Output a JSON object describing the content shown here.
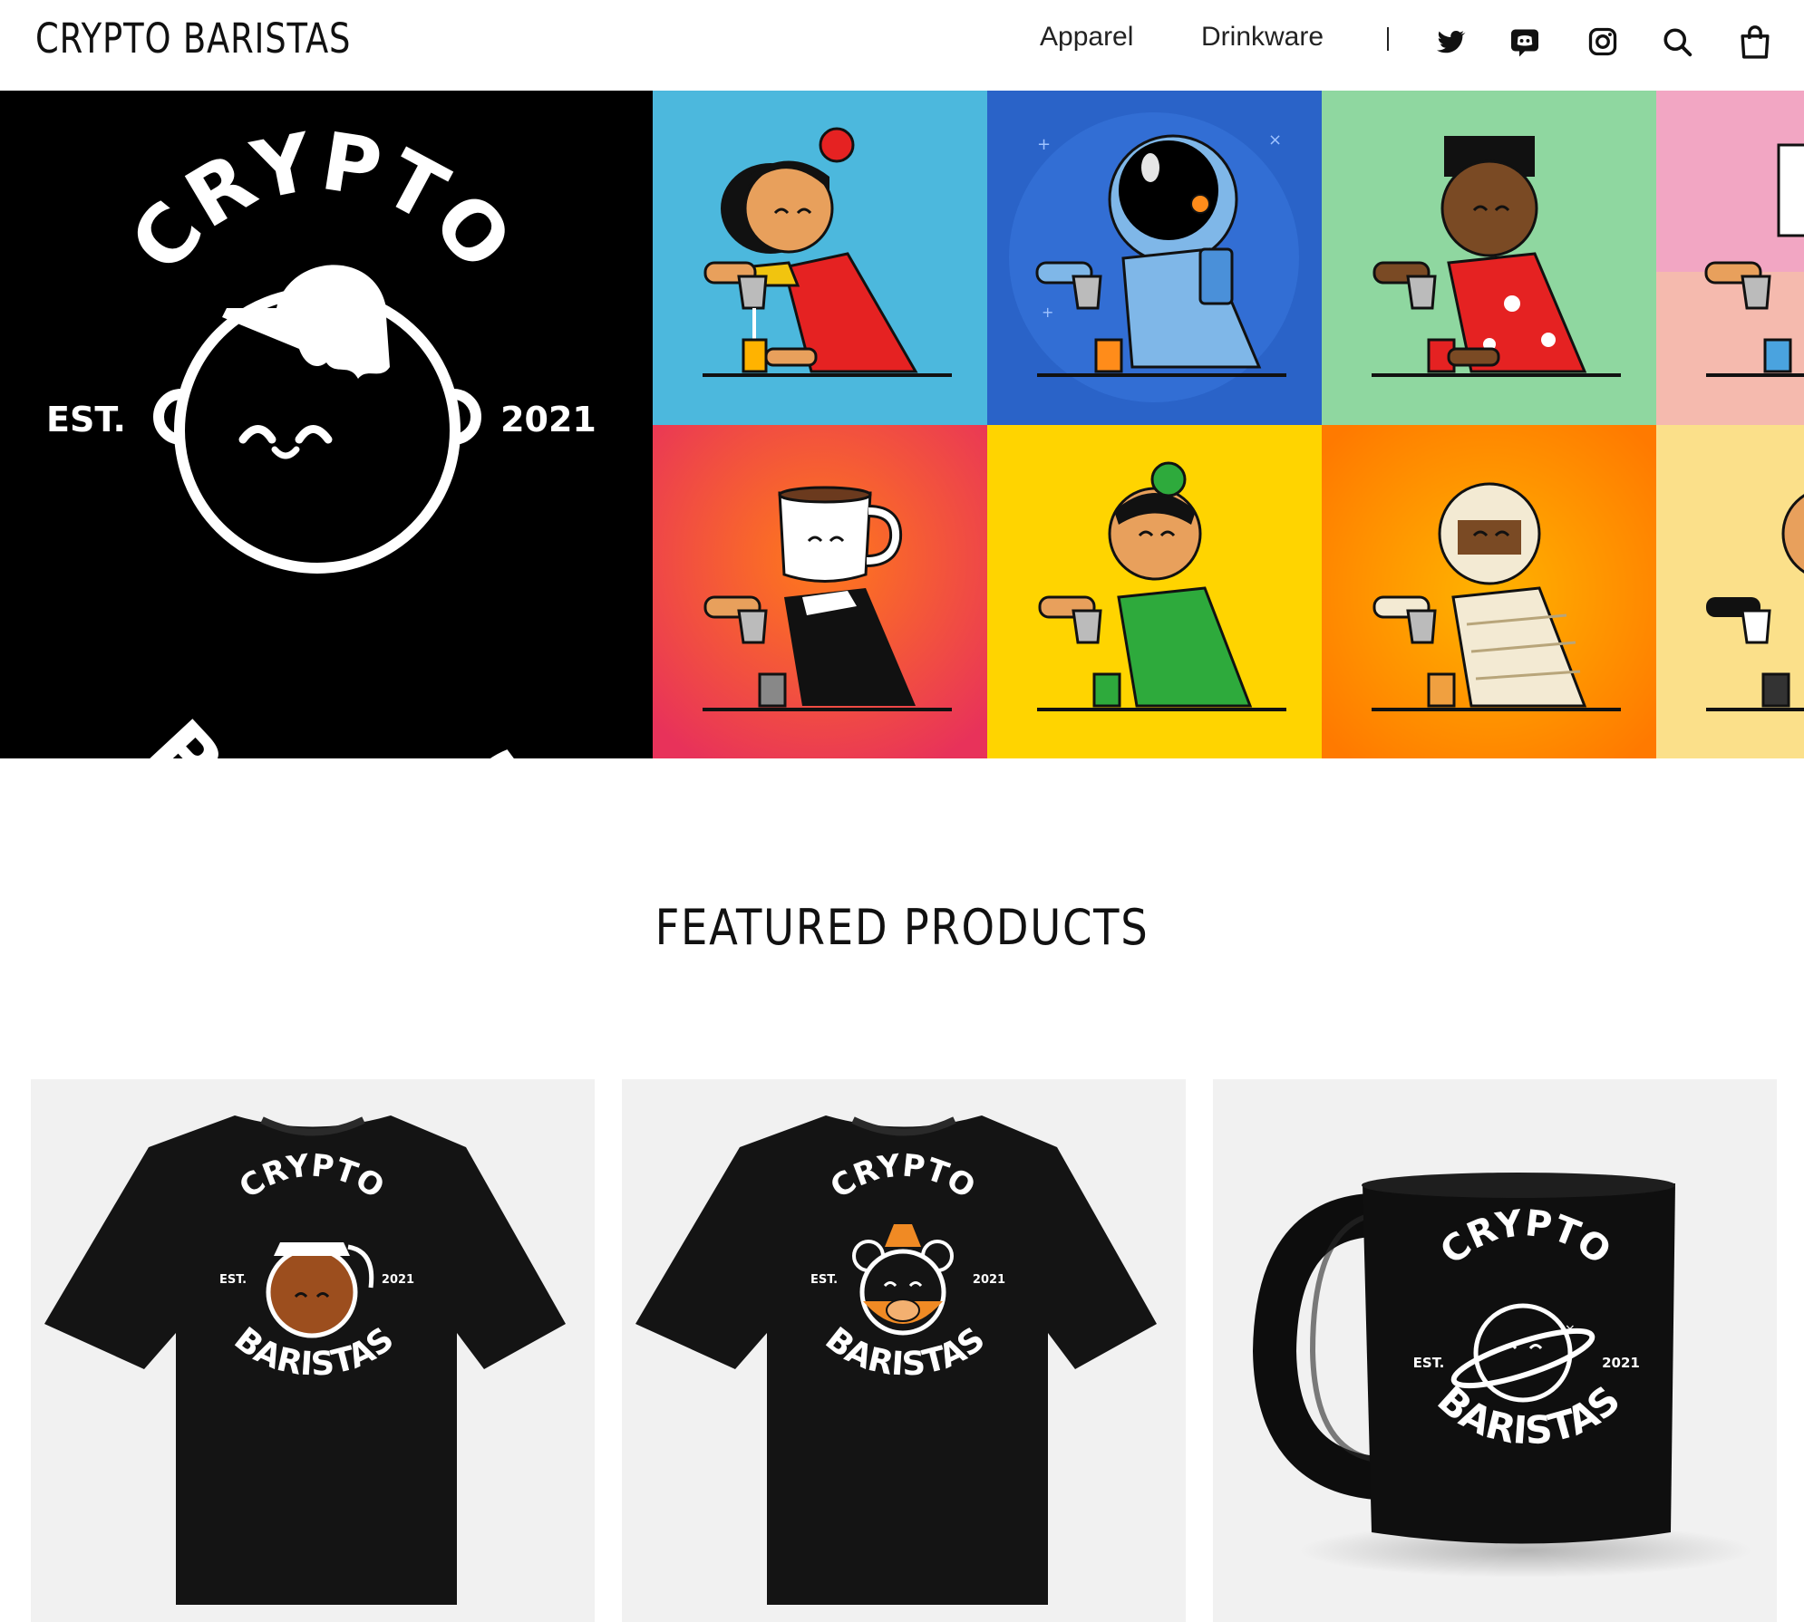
{
  "header": {
    "brand": "CRYPTO BARISTAS",
    "nav": [
      {
        "label": "Apparel"
      },
      {
        "label": "Drinkware"
      }
    ],
    "separator": "|",
    "icons": [
      "twitter-icon",
      "discord-icon",
      "instagram-icon",
      "search-icon",
      "cart-icon"
    ]
  },
  "hero": {
    "logo": {
      "top": "CRYPTO",
      "bottom": "BARISTAS",
      "left": "EST.",
      "right": "2021"
    },
    "tiles": [
      {
        "character": "barista-red-cap",
        "bg": "#4cb8dd"
      },
      {
        "character": "astronaut",
        "bg": "#2a63c8"
      },
      {
        "character": "barista-hawaiian-shirt",
        "bg": "#8fd7a0"
      },
      {
        "character": "barista-milk-carton",
        "bg": "#f2a6c3"
      },
      {
        "character": "coffee-mug-head",
        "bg": "#ec4a4a"
      },
      {
        "character": "barista-green-cap",
        "bg": "#ffd400"
      },
      {
        "character": "mummy",
        "bg": "#ff8f1a"
      },
      {
        "character": "barista-beanie",
        "bg": "#fbe08a"
      }
    ]
  },
  "featured": {
    "title": "FEATURED PRODUCTS",
    "products": [
      {
        "type": "tshirt",
        "graphic": "coffee-pot",
        "top": "CRYPTO",
        "bottom": "BARISTAS",
        "left": "EST.",
        "right": "2021"
      },
      {
        "type": "tshirt",
        "graphic": "bear",
        "top": "CRYPTO",
        "bottom": "BARISTAS",
        "left": "EST.",
        "right": "2021"
      },
      {
        "type": "mug",
        "graphic": "planet",
        "top": "CRYPTO",
        "bottom": "BARISTAS",
        "left": "EST.",
        "right": "2021"
      }
    ]
  },
  "colors": {
    "background": "#ffffff",
    "text": "#111111",
    "card": "#f1f1f1",
    "accent_orange": "#f08a24"
  }
}
